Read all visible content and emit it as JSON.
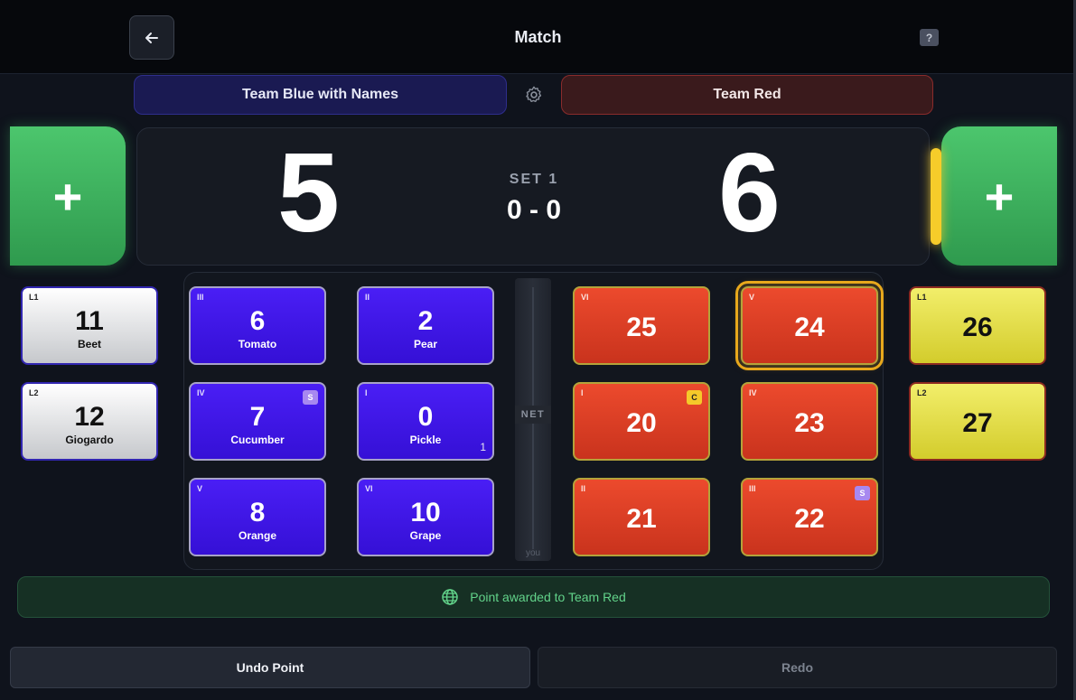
{
  "header": {
    "title": "Match",
    "back_icon": "arrow-left-icon",
    "help_label": "?"
  },
  "teams": {
    "blue": {
      "name": "Team Blue with Names",
      "color": "#3510d6"
    },
    "red": {
      "name": "Team Red",
      "color": "#c9331d"
    },
    "settings_icon": "gear-icon"
  },
  "score": {
    "blue": "5",
    "red": "6",
    "set_label": "SET 1",
    "set_score": "0 - 0",
    "plus_label": "+"
  },
  "court": {
    "net_label": "NET",
    "you_label": "you"
  },
  "blue_players": [
    {
      "pos": "III",
      "number": "6",
      "name": "Tomato"
    },
    {
      "pos": "II",
      "number": "2",
      "name": "Pear"
    },
    {
      "pos": "IV",
      "number": "7",
      "name": "Cucumber",
      "badge": "S"
    },
    {
      "pos": "I",
      "number": "0",
      "name": "Pickle",
      "corner": "1"
    },
    {
      "pos": "V",
      "number": "8",
      "name": "Orange"
    },
    {
      "pos": "VI",
      "number": "10",
      "name": "Grape"
    }
  ],
  "blue_bench": [
    {
      "pos": "L1",
      "number": "11",
      "name": "Beet"
    },
    {
      "pos": "L2",
      "number": "12",
      "name": "Giogardo"
    }
  ],
  "red_players": [
    {
      "pos": "VI",
      "number": "25"
    },
    {
      "pos": "V",
      "number": "24",
      "serving": true
    },
    {
      "pos": "I",
      "number": "20",
      "badge": "C"
    },
    {
      "pos": "IV",
      "number": "23"
    },
    {
      "pos": "II",
      "number": "21"
    },
    {
      "pos": "III",
      "number": "22",
      "badge": "S"
    }
  ],
  "red_bench": [
    {
      "pos": "L1",
      "number": "26"
    },
    {
      "pos": "L2",
      "number": "27"
    }
  ],
  "toast": {
    "icon": "globe-icon",
    "message": "Point awarded to Team Red"
  },
  "actions": {
    "undo": "Undo Point",
    "redo": "Redo"
  }
}
